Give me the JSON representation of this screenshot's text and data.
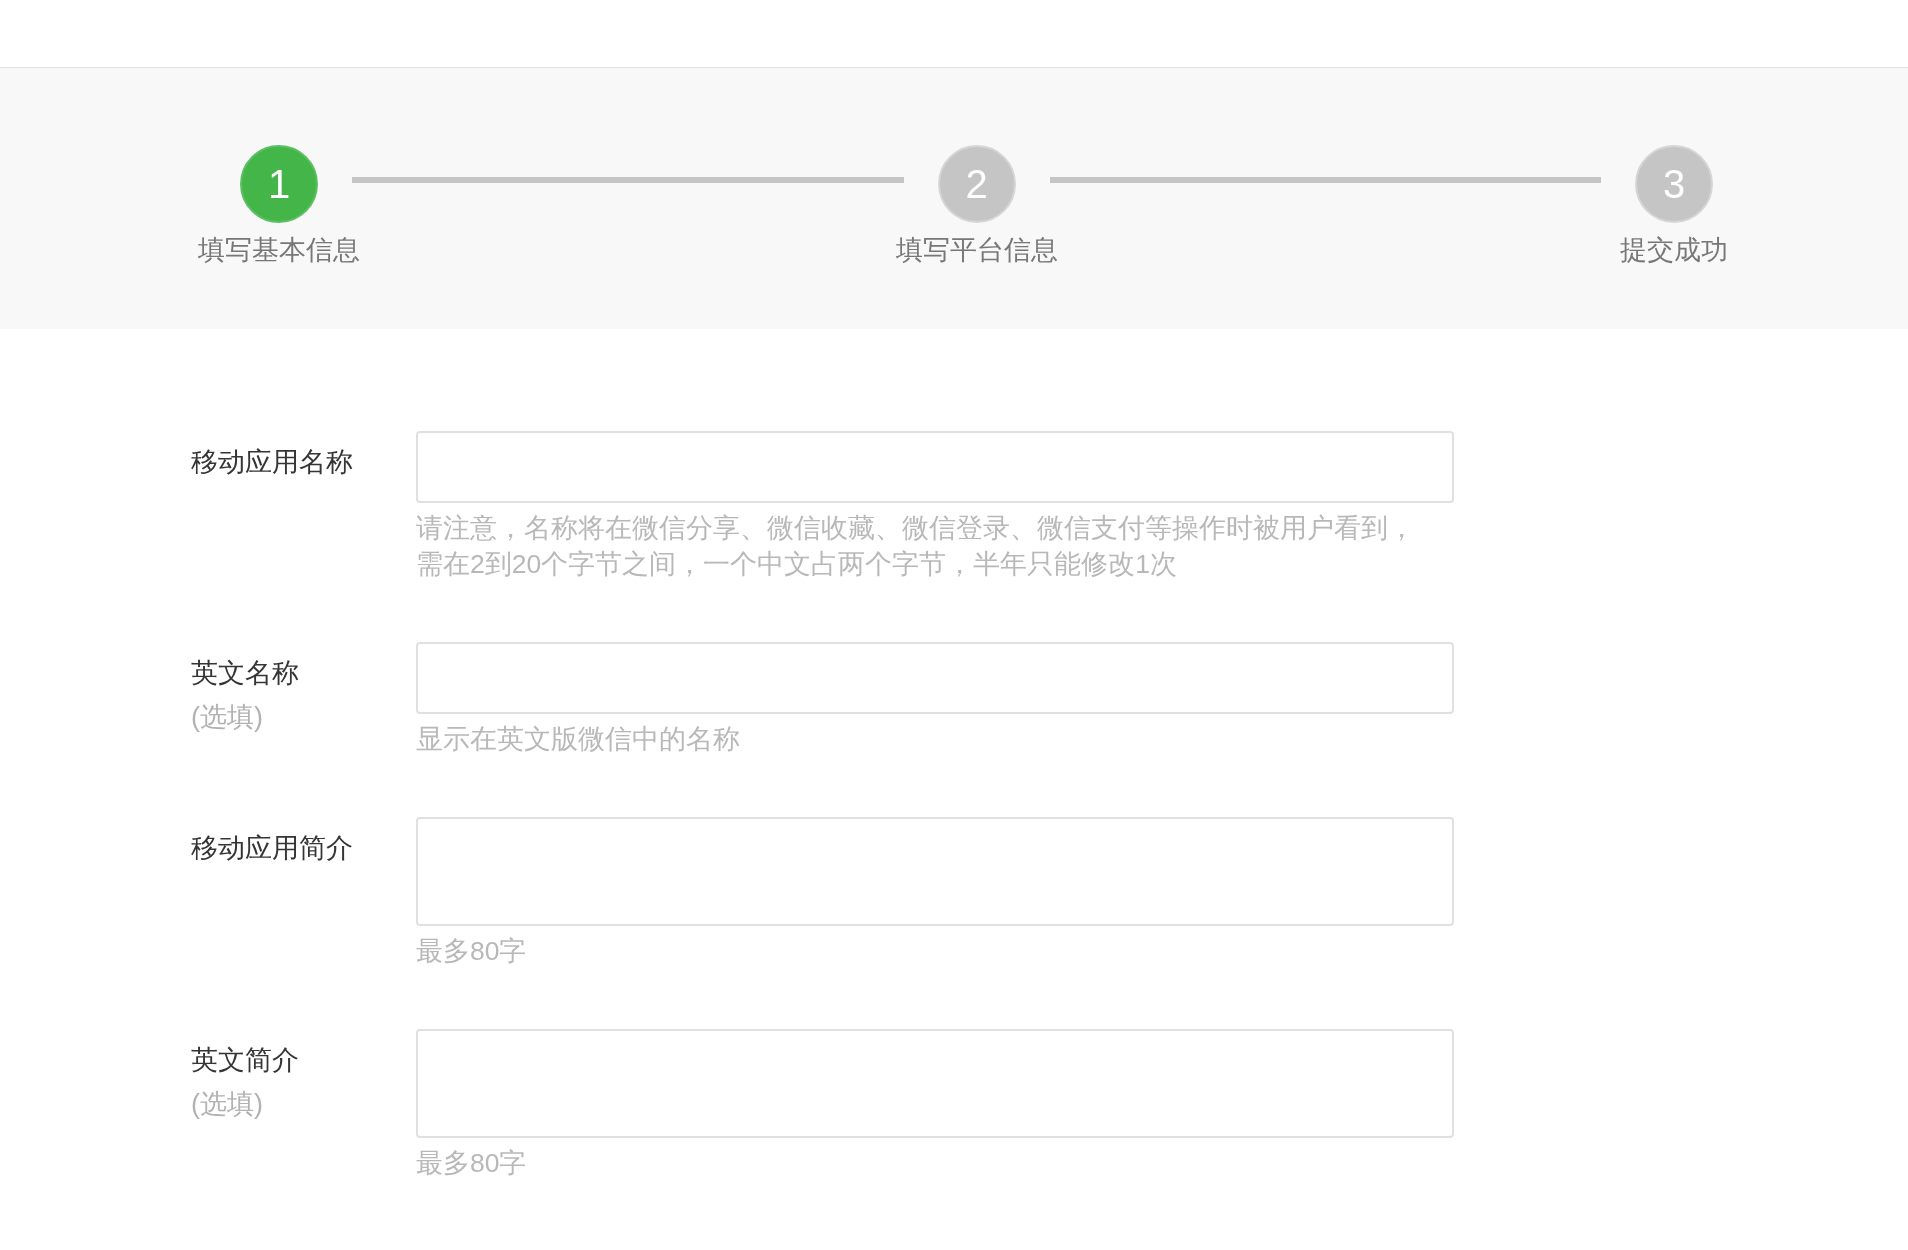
{
  "steps": [
    {
      "number": "1",
      "label": "填写基本信息",
      "selected": true
    },
    {
      "number": "2",
      "label": "填写平台信息",
      "selected": false
    },
    {
      "number": "3",
      "label": "提交成功",
      "selected": false
    }
  ],
  "fields": [
    {
      "kind": "input",
      "label": "移动应用名称",
      "hint_lines": [
        "请注意，名称将在微信分享、微信收藏、微信登录、微信支付等操作时被用户看到，",
        "需在2到20个字节之间，一个中文占两个字节，半年只能修改1次"
      ]
    },
    {
      "kind": "input",
      "label": "英文名称",
      "note": "(选填)",
      "hint_lines": [
        "显示在英文版微信中的名称"
      ]
    },
    {
      "kind": "textarea",
      "label": "移动应用简介",
      "hint_lines": [
        "最多80字"
      ]
    },
    {
      "kind": "textarea",
      "label": "英文简介",
      "note": "(选填)",
      "hint_lines": [
        "最多80字"
      ]
    }
  ]
}
